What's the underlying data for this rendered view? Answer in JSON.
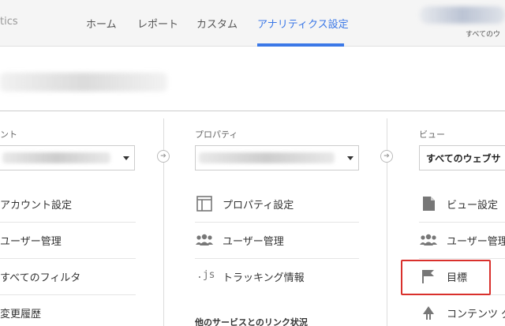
{
  "header": {
    "brand_fragment": "tics",
    "tabs": [
      {
        "label": "ホーム",
        "active": false
      },
      {
        "label": "レポート",
        "active": false
      },
      {
        "label": "カスタム",
        "active": false
      },
      {
        "label": "アナリティクス設定",
        "active": true
      }
    ],
    "account_subtext": "すべてのウ"
  },
  "columns": {
    "account": {
      "label": "ント",
      "items": [
        "アカウント設定",
        "ユーザー管理",
        "すべてのフィルタ",
        "変更履歴"
      ]
    },
    "property": {
      "label": "プロパティ",
      "items": [
        "プロパティ設定",
        "ユーザー管理",
        "トラッキング情報"
      ],
      "section_heading": "他のサービスとのリンク状況",
      "js_icon_text": ".js"
    },
    "view": {
      "label": "ビュー",
      "selected": "すべてのウェブサ",
      "items": [
        "ビュー設定",
        "ユーザー管理",
        "目標",
        "コンテンツ グ"
      ]
    }
  },
  "colors": {
    "accent": "#3b78e7",
    "highlight": "#d9302c"
  }
}
